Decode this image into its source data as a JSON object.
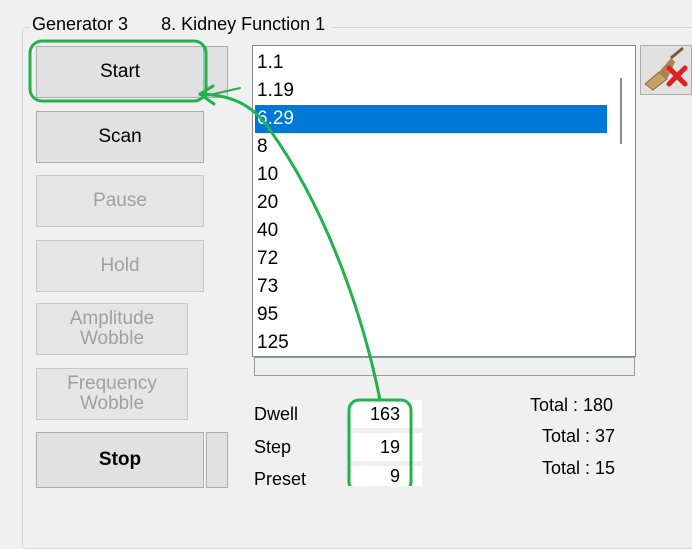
{
  "group": {
    "generator": "Generator 3",
    "program": "8. Kidney Function 1"
  },
  "buttons": {
    "start": "Start",
    "scan": "Scan",
    "pause": "Pause",
    "hold": "Hold",
    "amplitude_wobble_1": "Amplitude",
    "amplitude_wobble_2": "Wobble",
    "frequency_wobble_1": "Frequency",
    "frequency_wobble_2": "Wobble",
    "stop": "Stop"
  },
  "frequencies": {
    "items": [
      "1.1",
      "1.19",
      "6.29",
      "8",
      "10",
      "20",
      "40",
      "72",
      "73",
      "95",
      "125"
    ],
    "selected": "6.29"
  },
  "settings": {
    "dwell_label": "Dwell",
    "dwell_value": "163",
    "step_label": "Step",
    "step_value": "19",
    "preset_label": "Preset",
    "preset_value": "9"
  },
  "totals": {
    "total1": "Total : 180",
    "total2": "Total : 37",
    "total3": "Total : 15"
  },
  "icons": {
    "erase": "broom-cross-icon"
  },
  "colors": {
    "selection": "#0078d7",
    "annotation": "#22b14c"
  }
}
